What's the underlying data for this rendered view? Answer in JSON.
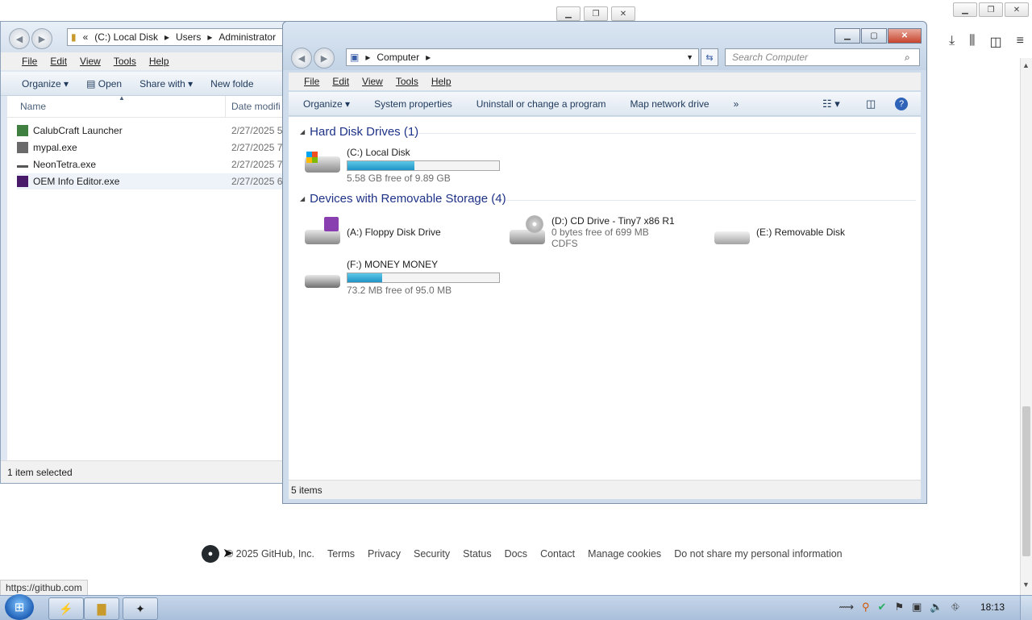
{
  "browser": {
    "status_url": "https://github.com",
    "footer": {
      "copyright": "© 2025 GitHub, Inc.",
      "links": [
        "Terms",
        "Privacy",
        "Security",
        "Status",
        "Docs",
        "Contact",
        "Manage cookies",
        "Do not share my personal information"
      ]
    },
    "toolbar_icons": [
      "download-icon",
      "library-icon",
      "sidebar-icon",
      "menu-icon"
    ]
  },
  "back_window": {
    "address": {
      "chevrons": "«",
      "crumbs": [
        "(C:) Local Disk",
        "Users",
        "Administrator"
      ]
    },
    "menu": [
      "File",
      "Edit",
      "View",
      "Tools",
      "Help"
    ],
    "commands": [
      "Organize ▾",
      "Open",
      "Share with ▾",
      "New folde"
    ],
    "columns": {
      "name": "Name",
      "date": "Date modifi"
    },
    "files": [
      {
        "name": "CalubCraft Launcher",
        "date": "2/27/2025 5:",
        "icon": "launcher-icon"
      },
      {
        "name": "mypal.exe",
        "date": "2/27/2025 7:",
        "icon": "mypal-icon"
      },
      {
        "name": "NeonTetra.exe",
        "date": "2/27/2025 7:",
        "icon": "neontetra-icon"
      },
      {
        "name": "OEM Info Editor.exe",
        "date": "2/27/2025 6:",
        "icon": "oem-icon",
        "selected": true
      }
    ],
    "status": "1 item selected"
  },
  "front_window": {
    "address": {
      "crumb": "Computer"
    },
    "search_placeholder": "Search Computer",
    "menu": [
      "File",
      "Edit",
      "View",
      "Tools",
      "Help"
    ],
    "commands": [
      "Organize ▾",
      "System properties",
      "Uninstall or change a program",
      "Map network drive",
      "»"
    ],
    "groups": [
      {
        "title": "Hard Disk Drives (1)",
        "drives": [
          {
            "name": "(C:) Local Disk",
            "free": "5.58 GB free of 9.89 GB",
            "used_fraction": 0.44,
            "icon": "hard-disk-icon"
          }
        ]
      },
      {
        "title": "Devices with Removable Storage (4)",
        "drives": [
          {
            "name": "(A:) Floppy Disk Drive",
            "icon": "floppy-drive-icon"
          },
          {
            "name": "(D:) CD Drive - Tiny7 x86 R1",
            "free": "0 bytes free of 699 MB",
            "fs": "CDFS",
            "icon": "cd-drive-icon"
          },
          {
            "name": "(E:) Removable Disk",
            "icon": "removable-disk-icon"
          },
          {
            "name": "(F:) MONEY MONEY",
            "free": "73.2 MB free of 95.0 MB",
            "used_fraction": 0.23,
            "icon": "usb-drive-icon"
          }
        ]
      }
    ],
    "status": "5 items"
  },
  "taskbar": {
    "clock": "18:13"
  }
}
